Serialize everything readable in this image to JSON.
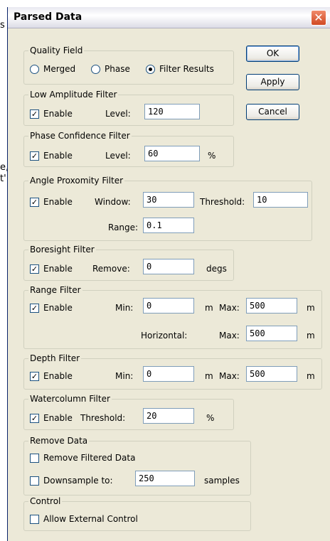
{
  "background_text": [
    "s",
    "e,",
    "t'"
  ],
  "window": {
    "title": "Parsed Data",
    "close_glyph": "✕"
  },
  "buttons": {
    "ok": "OK",
    "apply": "Apply",
    "cancel": "Cancel"
  },
  "quality_field": {
    "legend": "Quality Field",
    "options": [
      "Merged",
      "Phase",
      "Filter Results"
    ],
    "selected": "Filter Results"
  },
  "low_amplitude": {
    "legend": "Low Amplitude Filter",
    "enable_label": "Enable",
    "enabled": true,
    "level_label": "Level:",
    "level": "120"
  },
  "phase_confidence": {
    "legend": "Phase Confidence Filter",
    "enable_label": "Enable",
    "enabled": true,
    "level_label": "Level:",
    "level": "60",
    "unit": "%"
  },
  "angle_proximity": {
    "legend": "Angle Proxomity Filter",
    "enable_label": "Enable",
    "enabled": true,
    "window_label": "Window:",
    "window": "30",
    "threshold_label": "Threshold:",
    "threshold": "10",
    "range_label": "Range:",
    "range": "0.1"
  },
  "boresight": {
    "legend": "Boresight Filter",
    "enable_label": "Enable",
    "enabled": true,
    "remove_label": "Remove:",
    "remove": "0",
    "unit": "degs"
  },
  "range_filter": {
    "legend": "Range Filter",
    "enable_label": "Enable",
    "enabled": true,
    "min_label": "Min:",
    "min": "0",
    "min_unit": "m",
    "max_label": "Max:",
    "max": "500",
    "max_unit": "m",
    "horizontal_label": "Horizontal:",
    "h_max_label": "Max:",
    "h_max": "500",
    "h_max_unit": "m"
  },
  "depth_filter": {
    "legend": "Depth Filter",
    "enable_label": "Enable",
    "enabled": true,
    "min_label": "Min:",
    "min": "0",
    "min_unit": "m",
    "max_label": "Max:",
    "max": "500",
    "max_unit": "m"
  },
  "watercolumn": {
    "legend": "Watercolumn Filter",
    "enable_label": "Enable",
    "enabled": true,
    "threshold_label": "Threshold:",
    "threshold": "20",
    "unit": "%"
  },
  "remove_data": {
    "legend": "Remove Data",
    "remove_filtered_label": "Remove Filtered Data",
    "remove_filtered": false,
    "downsample_label": "Downsample to:",
    "downsample": false,
    "downsample_value": "250",
    "downsample_unit": "samples"
  },
  "control": {
    "legend": "Control",
    "external_label": "Allow External Control",
    "external": false
  },
  "icons": {
    "check": "check-icon",
    "close": "close-icon"
  }
}
